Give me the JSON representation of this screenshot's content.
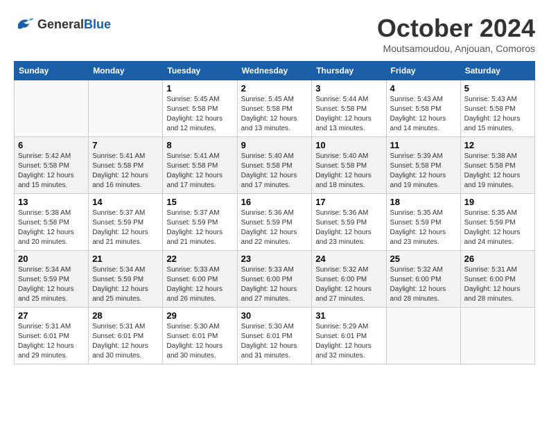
{
  "header": {
    "logo_line1": "General",
    "logo_line2": "Blue",
    "month_title": "October 2024",
    "subtitle": "Moutsamoudou, Anjouan, Comoros"
  },
  "weekdays": [
    "Sunday",
    "Monday",
    "Tuesday",
    "Wednesday",
    "Thursday",
    "Friday",
    "Saturday"
  ],
  "weeks": [
    [
      {
        "day": "",
        "info": ""
      },
      {
        "day": "",
        "info": ""
      },
      {
        "day": "1",
        "info": "Sunrise: 5:45 AM\nSunset: 5:58 PM\nDaylight: 12 hours\nand 12 minutes."
      },
      {
        "day": "2",
        "info": "Sunrise: 5:45 AM\nSunset: 5:58 PM\nDaylight: 12 hours\nand 13 minutes."
      },
      {
        "day": "3",
        "info": "Sunrise: 5:44 AM\nSunset: 5:58 PM\nDaylight: 12 hours\nand 13 minutes."
      },
      {
        "day": "4",
        "info": "Sunrise: 5:43 AM\nSunset: 5:58 PM\nDaylight: 12 hours\nand 14 minutes."
      },
      {
        "day": "5",
        "info": "Sunrise: 5:43 AM\nSunset: 5:58 PM\nDaylight: 12 hours\nand 15 minutes."
      }
    ],
    [
      {
        "day": "6",
        "info": "Sunrise: 5:42 AM\nSunset: 5:58 PM\nDaylight: 12 hours\nand 15 minutes."
      },
      {
        "day": "7",
        "info": "Sunrise: 5:41 AM\nSunset: 5:58 PM\nDaylight: 12 hours\nand 16 minutes."
      },
      {
        "day": "8",
        "info": "Sunrise: 5:41 AM\nSunset: 5:58 PM\nDaylight: 12 hours\nand 17 minutes."
      },
      {
        "day": "9",
        "info": "Sunrise: 5:40 AM\nSunset: 5:58 PM\nDaylight: 12 hours\nand 17 minutes."
      },
      {
        "day": "10",
        "info": "Sunrise: 5:40 AM\nSunset: 5:58 PM\nDaylight: 12 hours\nand 18 minutes."
      },
      {
        "day": "11",
        "info": "Sunrise: 5:39 AM\nSunset: 5:58 PM\nDaylight: 12 hours\nand 19 minutes."
      },
      {
        "day": "12",
        "info": "Sunrise: 5:38 AM\nSunset: 5:58 PM\nDaylight: 12 hours\nand 19 minutes."
      }
    ],
    [
      {
        "day": "13",
        "info": "Sunrise: 5:38 AM\nSunset: 5:58 PM\nDaylight: 12 hours\nand 20 minutes."
      },
      {
        "day": "14",
        "info": "Sunrise: 5:37 AM\nSunset: 5:59 PM\nDaylight: 12 hours\nand 21 minutes."
      },
      {
        "day": "15",
        "info": "Sunrise: 5:37 AM\nSunset: 5:59 PM\nDaylight: 12 hours\nand 21 minutes."
      },
      {
        "day": "16",
        "info": "Sunrise: 5:36 AM\nSunset: 5:59 PM\nDaylight: 12 hours\nand 22 minutes."
      },
      {
        "day": "17",
        "info": "Sunrise: 5:36 AM\nSunset: 5:59 PM\nDaylight: 12 hours\nand 23 minutes."
      },
      {
        "day": "18",
        "info": "Sunrise: 5:35 AM\nSunset: 5:59 PM\nDaylight: 12 hours\nand 23 minutes."
      },
      {
        "day": "19",
        "info": "Sunrise: 5:35 AM\nSunset: 5:59 PM\nDaylight: 12 hours\nand 24 minutes."
      }
    ],
    [
      {
        "day": "20",
        "info": "Sunrise: 5:34 AM\nSunset: 5:59 PM\nDaylight: 12 hours\nand 25 minutes."
      },
      {
        "day": "21",
        "info": "Sunrise: 5:34 AM\nSunset: 5:59 PM\nDaylight: 12 hours\nand 25 minutes."
      },
      {
        "day": "22",
        "info": "Sunrise: 5:33 AM\nSunset: 6:00 PM\nDaylight: 12 hours\nand 26 minutes."
      },
      {
        "day": "23",
        "info": "Sunrise: 5:33 AM\nSunset: 6:00 PM\nDaylight: 12 hours\nand 27 minutes."
      },
      {
        "day": "24",
        "info": "Sunrise: 5:32 AM\nSunset: 6:00 PM\nDaylight: 12 hours\nand 27 minutes."
      },
      {
        "day": "25",
        "info": "Sunrise: 5:32 AM\nSunset: 6:00 PM\nDaylight: 12 hours\nand 28 minutes."
      },
      {
        "day": "26",
        "info": "Sunrise: 5:31 AM\nSunset: 6:00 PM\nDaylight: 12 hours\nand 28 minutes."
      }
    ],
    [
      {
        "day": "27",
        "info": "Sunrise: 5:31 AM\nSunset: 6:01 PM\nDaylight: 12 hours\nand 29 minutes."
      },
      {
        "day": "28",
        "info": "Sunrise: 5:31 AM\nSunset: 6:01 PM\nDaylight: 12 hours\nand 30 minutes."
      },
      {
        "day": "29",
        "info": "Sunrise: 5:30 AM\nSunset: 6:01 PM\nDaylight: 12 hours\nand 30 minutes."
      },
      {
        "day": "30",
        "info": "Sunrise: 5:30 AM\nSunset: 6:01 PM\nDaylight: 12 hours\nand 31 minutes."
      },
      {
        "day": "31",
        "info": "Sunrise: 5:29 AM\nSunset: 6:01 PM\nDaylight: 12 hours\nand 32 minutes."
      },
      {
        "day": "",
        "info": ""
      },
      {
        "day": "",
        "info": ""
      }
    ]
  ]
}
